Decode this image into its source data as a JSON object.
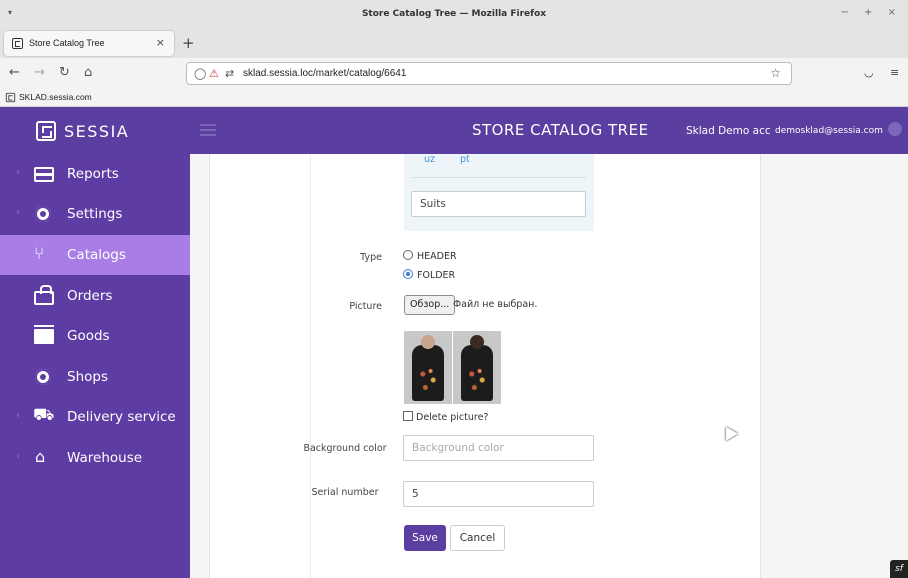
{
  "browser": {
    "window_title": "Store Catalog Tree — Mozilla Firefox",
    "window_controls": "− + ×",
    "tab_title": "Store Catalog Tree",
    "url": "sklad.sessia.loc/market/catalog/6641",
    "bookmark": "SKLAD.sessia.com"
  },
  "header": {
    "logo": "SESSIA",
    "page_title": "STORE CATALOG TREE",
    "user_name": "Sklad Demo acc",
    "user_email": "demosklad@sessia.com"
  },
  "sidebar": {
    "items": [
      {
        "label": "Reports",
        "icon": "credit-card-icon",
        "active": false
      },
      {
        "label": "Settings",
        "icon": "gear-icon",
        "active": false
      },
      {
        "label": "Catalogs",
        "icon": "branch-icon",
        "active": true
      },
      {
        "label": "Orders",
        "icon": "shopping-bag-icon",
        "active": false
      },
      {
        "label": "Goods",
        "icon": "box-icon",
        "active": false
      },
      {
        "label": "Shops",
        "icon": "gear-icon",
        "active": false
      },
      {
        "label": "Delivery service",
        "icon": "truck-icon",
        "active": false
      },
      {
        "label": "Warehouse",
        "icon": "warehouse-icon",
        "active": false
      }
    ]
  },
  "form": {
    "languages": [
      "uz",
      "pt"
    ],
    "name_value": "Suits",
    "type_label": "Type",
    "type_options": [
      {
        "label": "HEADER",
        "checked": false
      },
      {
        "label": "FOLDER",
        "checked": true
      }
    ],
    "picture_label": "Picture",
    "file_button": "Обзор...",
    "file_status": "Файл не выбран.",
    "delete_picture_label": "Delete picture?",
    "background_label": "Background color",
    "background_placeholder": "Background color",
    "serial_label": "Serial number",
    "serial_value": "5",
    "save_label": "Save",
    "cancel_label": "Cancel"
  },
  "colors": {
    "brand": "#5a3ea0",
    "sidebar_active": "#a97de6"
  }
}
